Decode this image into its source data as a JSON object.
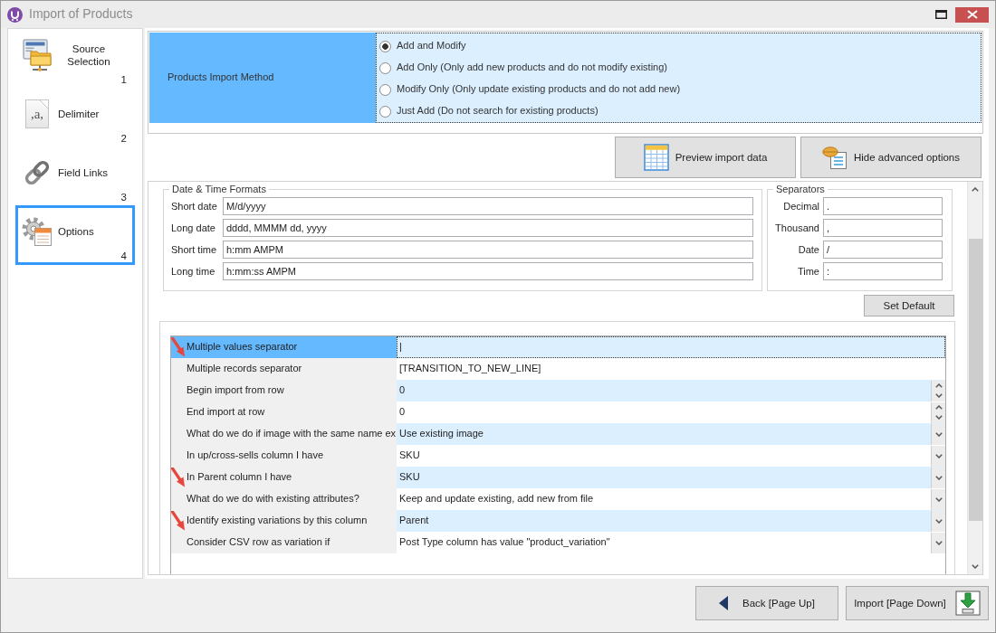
{
  "window": {
    "title": "Import of Products"
  },
  "steps": [
    {
      "kind": "source",
      "label": "Source Selection",
      "number": "1",
      "selected": false
    },
    {
      "kind": "delimiter",
      "glyph": ",a,",
      "label": "Delimiter",
      "number": "2",
      "selected": false
    },
    {
      "kind": "links",
      "label": "Field Links",
      "number": "3",
      "selected": false
    },
    {
      "kind": "options",
      "label": "Options",
      "number": "4",
      "selected": true
    }
  ],
  "import_method": {
    "label": "Products Import Method",
    "options": [
      {
        "label": "Add and Modify",
        "selected": true
      },
      {
        "label": "Add Only (Only add new products and do not modify existing)",
        "selected": false
      },
      {
        "label": "Modify Only (Only update existing products and do not add new)",
        "selected": false
      },
      {
        "label": "Just Add (Do not search for existing products)",
        "selected": false
      }
    ]
  },
  "toolbar_buttons": [
    {
      "kind": "preview",
      "label": "Preview import data"
    },
    {
      "kind": "toggle",
      "label": "Hide advanced options"
    }
  ],
  "date_time_formats": {
    "title": "Date & Time Formats",
    "fields": [
      {
        "label": "Short date",
        "value": "M/d/yyyy"
      },
      {
        "label": "Long date",
        "value": "dddd, MMMM dd, yyyy"
      },
      {
        "label": "Short time",
        "value": "h:mm AMPM"
      },
      {
        "label": "Long time",
        "value": "h:mm:ss AMPM"
      }
    ]
  },
  "separators": {
    "title": "Separators",
    "fields": [
      {
        "label": "Decimal",
        "value": "."
      },
      {
        "label": "Thousand",
        "value": ","
      },
      {
        "label": "Date",
        "value": "/"
      },
      {
        "label": "Time",
        "value": ":"
      }
    ]
  },
  "set_default_button": "Set Default",
  "properties": [
    {
      "label": "Multiple values separator",
      "value": "|",
      "kind": "text",
      "selected": true,
      "arrow": true
    },
    {
      "label": "Multiple records separator",
      "value": "[TRANSITION_TO_NEW_LINE]",
      "kind": "text",
      "selected": false,
      "arrow": false
    },
    {
      "label": "Begin import from row",
      "value": "0",
      "kind": "spin",
      "selected": false,
      "arrow": false
    },
    {
      "label": "End import at row",
      "value": "0",
      "kind": "spin",
      "selected": false,
      "arrow": false
    },
    {
      "label": "What do we do if image with the same name ex",
      "value": "Use existing image",
      "kind": "dropdown",
      "selected": false,
      "arrow": false
    },
    {
      "label": "In up/cross-sells column I have",
      "value": "SKU",
      "kind": "dropdown",
      "selected": false,
      "arrow": false
    },
    {
      "label": "In Parent column I have",
      "value": "SKU",
      "kind": "dropdown",
      "selected": false,
      "arrow": true
    },
    {
      "label": "What do we do with existing attributes?",
      "value": "Keep and update existing, add new from file",
      "kind": "dropdown",
      "selected": false,
      "arrow": false
    },
    {
      "label": "Identify existing variations by this column",
      "value": "Parent",
      "kind": "dropdown",
      "selected": false,
      "arrow": true
    },
    {
      "label": "Consider CSV row as variation if",
      "value": "Post Type column has value \"product_variation\"",
      "kind": "dropdown",
      "selected": false,
      "arrow": false
    }
  ],
  "footer_buttons": [
    {
      "kind": "back",
      "label": "Back [Page Up]"
    },
    {
      "kind": "import",
      "label": "Import [Page Down]"
    }
  ]
}
